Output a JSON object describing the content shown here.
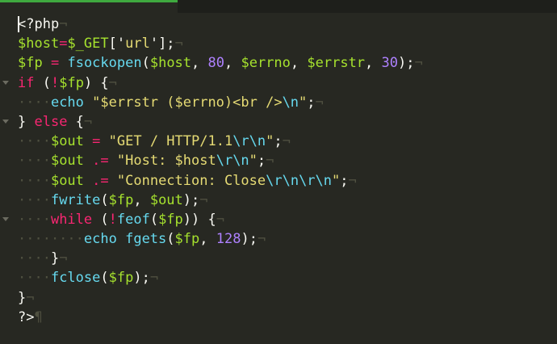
{
  "editor": {
    "lines": [
      [
        [
          "plain",
          "<?php"
        ],
        [
          "eol",
          "¬"
        ]
      ],
      [
        [
          "var-y",
          "$host"
        ],
        [
          "op",
          "="
        ],
        [
          "var-y",
          "$_GET"
        ],
        [
          "plain",
          "['"
        ],
        [
          "str",
          "url"
        ],
        [
          "plain",
          "'];"
        ],
        [
          "eol",
          "¬"
        ]
      ],
      [
        [
          "var-y",
          "$fp"
        ],
        [
          "plain",
          " "
        ],
        [
          "op",
          "="
        ],
        [
          "plain",
          " "
        ],
        [
          "fn",
          "fsockopen"
        ],
        [
          "plain",
          "("
        ],
        [
          "var-y",
          "$host"
        ],
        [
          "plain",
          ", "
        ],
        [
          "num",
          "80"
        ],
        [
          "plain",
          ", "
        ],
        [
          "var-y",
          "$errno"
        ],
        [
          "plain",
          ", "
        ],
        [
          "var-y",
          "$errstr"
        ],
        [
          "plain",
          ", "
        ],
        [
          "num",
          "30"
        ],
        [
          "plain",
          ");"
        ],
        [
          "eol",
          "¬"
        ]
      ],
      [
        [
          "kw",
          "if"
        ],
        [
          "plain",
          " ("
        ],
        [
          "op",
          "!"
        ],
        [
          "var-y",
          "$fp"
        ],
        [
          "plain",
          ") {"
        ],
        [
          "eol",
          "¬"
        ]
      ],
      [
        [
          "ws",
          "····"
        ],
        [
          "fn",
          "echo"
        ],
        [
          "plain",
          " "
        ],
        [
          "str",
          "\"$errstr ($errno)<br />"
        ],
        [
          "esc",
          "\\n"
        ],
        [
          "str",
          "\""
        ],
        [
          "plain",
          ";"
        ],
        [
          "eol",
          "¬"
        ]
      ],
      [
        [
          "plain",
          "} "
        ],
        [
          "kw",
          "else"
        ],
        [
          "plain",
          " {"
        ],
        [
          "eol",
          "¬"
        ]
      ],
      [
        [
          "ws",
          "····"
        ],
        [
          "var-y",
          "$out"
        ],
        [
          "plain",
          " "
        ],
        [
          "op",
          "="
        ],
        [
          "plain",
          " "
        ],
        [
          "str",
          "\"GET / HTTP/1.1"
        ],
        [
          "esc",
          "\\r\\n"
        ],
        [
          "str",
          "\""
        ],
        [
          "plain",
          ";"
        ],
        [
          "eol",
          "¬"
        ]
      ],
      [
        [
          "ws",
          "····"
        ],
        [
          "var-y",
          "$out"
        ],
        [
          "plain",
          " "
        ],
        [
          "op",
          ".="
        ],
        [
          "plain",
          " "
        ],
        [
          "str",
          "\"Host: $host"
        ],
        [
          "esc",
          "\\r\\n"
        ],
        [
          "str",
          "\""
        ],
        [
          "plain",
          ";"
        ],
        [
          "eol",
          "¬"
        ]
      ],
      [
        [
          "ws",
          "····"
        ],
        [
          "var-y",
          "$out"
        ],
        [
          "plain",
          " "
        ],
        [
          "op",
          ".="
        ],
        [
          "plain",
          " "
        ],
        [
          "str",
          "\"Connection: Close"
        ],
        [
          "esc",
          "\\r\\n\\r\\n"
        ],
        [
          "str",
          "\""
        ],
        [
          "plain",
          ";"
        ],
        [
          "eol",
          "¬"
        ]
      ],
      [
        [
          "ws",
          "····"
        ],
        [
          "fn",
          "fwrite"
        ],
        [
          "plain",
          "("
        ],
        [
          "var-y",
          "$fp"
        ],
        [
          "plain",
          ", "
        ],
        [
          "var-y",
          "$out"
        ],
        [
          "plain",
          ");"
        ],
        [
          "eol",
          "¬"
        ]
      ],
      [
        [
          "ws",
          "····"
        ],
        [
          "kw",
          "while"
        ],
        [
          "plain",
          " ("
        ],
        [
          "op",
          "!"
        ],
        [
          "fn",
          "feof"
        ],
        [
          "plain",
          "("
        ],
        [
          "var-y",
          "$fp"
        ],
        [
          "plain",
          ")) {"
        ],
        [
          "eol",
          "¬"
        ]
      ],
      [
        [
          "ws",
          "········"
        ],
        [
          "fn",
          "echo"
        ],
        [
          "plain",
          " "
        ],
        [
          "fn",
          "fgets"
        ],
        [
          "plain",
          "("
        ],
        [
          "var-y",
          "$fp"
        ],
        [
          "plain",
          ", "
        ],
        [
          "num",
          "128"
        ],
        [
          "plain",
          ");"
        ],
        [
          "eol",
          "¬"
        ]
      ],
      [
        [
          "ws",
          "····"
        ],
        [
          "plain",
          "}"
        ],
        [
          "eol",
          "¬"
        ]
      ],
      [
        [
          "ws",
          "····"
        ],
        [
          "fn",
          "fclose"
        ],
        [
          "plain",
          "("
        ],
        [
          "var-y",
          "$fp"
        ],
        [
          "plain",
          ");"
        ],
        [
          "eol",
          "¬"
        ]
      ],
      [
        [
          "plain",
          "}"
        ],
        [
          "eol",
          "¬"
        ]
      ],
      [
        [
          "plain",
          "?>"
        ],
        [
          "eol",
          "¶"
        ]
      ]
    ],
    "fold_lines": [
      3,
      5,
      10
    ]
  },
  "colors": {
    "background": "#272822",
    "keyword": "#f92672",
    "function": "#66d9ef",
    "variable": "#a6e22e",
    "string": "#e6db74",
    "number": "#ae81ff",
    "tab_accent": "#3fa93f"
  }
}
